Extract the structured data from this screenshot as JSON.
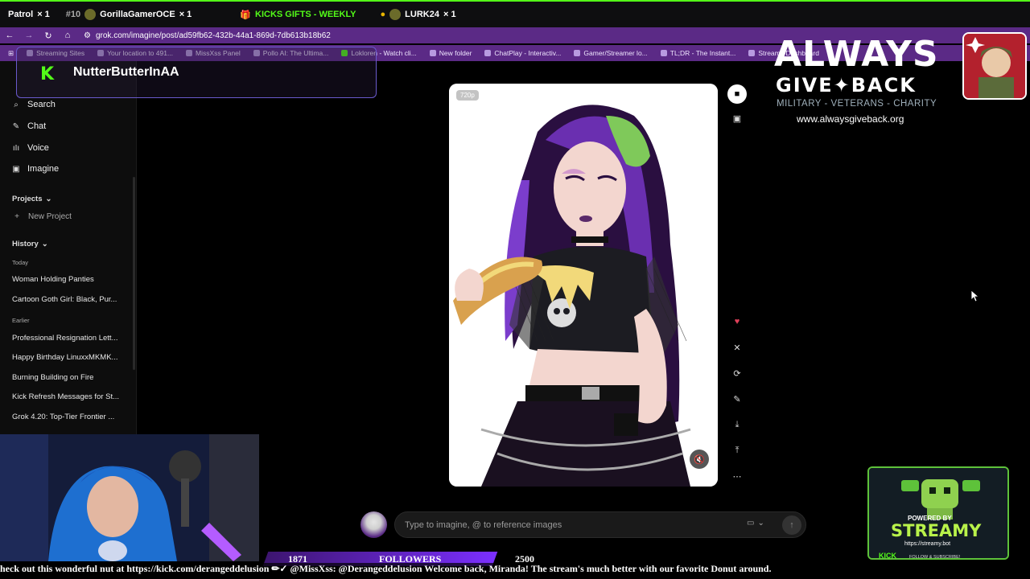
{
  "streambar": {
    "item1": "Patrol",
    "item1_count": "× 1",
    "item2_rank": "#10",
    "item2_name": "GorillaGamerOCE",
    "item2_count": "× 1",
    "gift_label": "KICKS GIFTS - WEEKLY",
    "item3_name": "LURK24",
    "item3_count": "× 1"
  },
  "browser": {
    "url": "grok.com/imagine/post/ad59fb62-432b-44a1-869d-7db613b18b62",
    "bookmarks": [
      "Streaming Sites",
      "Your location to 491...",
      "MissXss Panel",
      "Pollo AI: The Ultima...",
      "Lokloren - Watch cli...",
      "New folder",
      "ChatPlay - Interactiv...",
      "Gamer/Streamer lo...",
      "TL;DR - The Instant...",
      "Streamy Dashboard"
    ]
  },
  "overlay": {
    "kick_logo": "K",
    "username": "NutterButterInAA"
  },
  "sidebar": {
    "search": "Search",
    "chat": "Chat",
    "voice": "Voice",
    "imagine": "Imagine",
    "projects_label": "Projects",
    "new_project": "New Project",
    "history_label": "History",
    "today_label": "Today",
    "earlier_label": "Earlier",
    "today_items": [
      "Woman Holding Panties",
      "Cartoon Goth Girl: Black, Pur..."
    ],
    "earlier_items": [
      "Professional Resignation Lett...",
      "Happy Birthday LinuxxMKMK...",
      "Burning Building on Fire",
      "Kick Refresh Messages for St...",
      "Grok 4.20: Top-Tier Frontier ..."
    ]
  },
  "main": {
    "resolution_badge": "720p",
    "prompt_placeholder": "Type to imagine, @ to reference images"
  },
  "agb": {
    "title_line1": "ALWAYS",
    "title_line2": "GIVE✦BACK",
    "subtitle": "MILITARY - VETERANS - CHARITY",
    "url": "www.alwaysgiveback.org"
  },
  "streamy": {
    "powered_by": "POWERED BY",
    "name": "STREAMY",
    "url": "https://streamy.bot",
    "kick": "KICK",
    "follow": "FOLLOW & SUBSCRIBE!"
  },
  "followers": {
    "current": "1871",
    "label": "FOLLOWERS",
    "goal": "2500"
  },
  "ticker": {
    "text": "heck out this wonderful nut at https://kick.com/derangeddelusion ✏✓ @MissXss: @Derangeddelusion Welcome back, Miranda! The stream's much better with our favorite Donut around."
  },
  "colors": {
    "accent_kick": "#53fc18",
    "browser_purple": "#5b2a86",
    "agb_red": "#b3212d"
  }
}
